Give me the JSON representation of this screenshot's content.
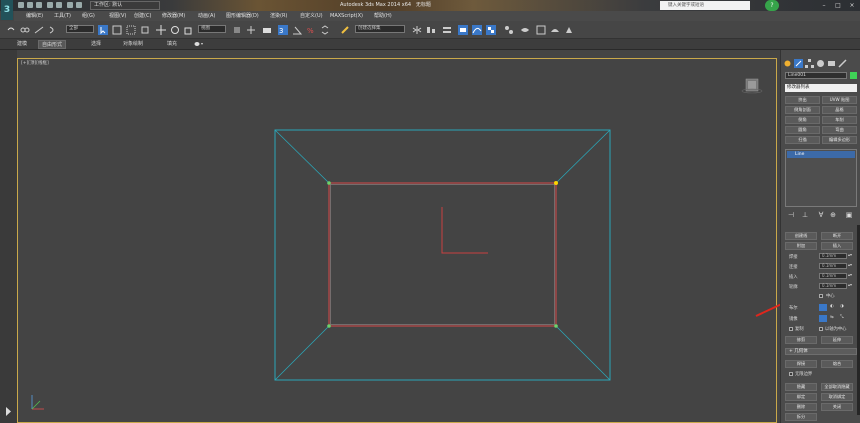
{
  "titlebar": {
    "workspace": "工作区: 默认",
    "window_title": "Autodesk 3ds Max  2014 x64",
    "file_name": "无标题",
    "search_placeholder": "键入关键字或短语",
    "help_symbol": "?"
  },
  "menu": {
    "items": [
      "编辑(E)",
      "工具(T)",
      "组(G)",
      "视图(V)",
      "创建(C)",
      "修改器(M)",
      "动画(A)",
      "图形编辑器(D)",
      "渲染(R)",
      "自定义(U)",
      "MAXScript(X)",
      "帮助(H)"
    ]
  },
  "toolbar": {
    "view_value": "全部",
    "ref_coord_value": "视图",
    "selection_set_value": "创建选择集"
  },
  "ribbon": {
    "tabs": [
      "建模",
      "自由形式",
      "选择",
      "对象绘制",
      "填充"
    ],
    "active_index": 1
  },
  "viewport": {
    "label": "[+][顶][线框]"
  },
  "command_panel": {
    "object_name": "Line001",
    "modifier_list": "修改器列表",
    "buttons": [
      "挤出",
      "UVW 贴图",
      "倒角剖面",
      "晶格",
      "倒角",
      "车削",
      "圆角",
      "弯曲",
      "扫描",
      "编辑多边形"
    ],
    "stack_item": "Line",
    "params": [
      {
        "label": "连接",
        "button": "附加"
      },
      {
        "label": "优化",
        "button": "插入"
      },
      {
        "label": "焊接",
        "value": "0.1mm"
      },
      {
        "label": "连接",
        "value": "0.1mm"
      },
      {
        "label": "插入",
        "value": "0.1mm"
      },
      {
        "label": "轮廓",
        "value": "0.1mm"
      }
    ],
    "center_label": "中心",
    "boolean_label": "布尔",
    "mirror_label": "镜像",
    "copy_label": "复制",
    "pivot_label": "以轴为中心",
    "trim_label": "修剪",
    "extend_label": "延伸",
    "infinite_label": "无限边界",
    "rollout_title": "+ 几何体",
    "bottom_buttons": [
      "隐藏",
      "全部取消隐藏",
      "绑定",
      "取消绑定",
      "删除",
      "关闭",
      "拆分"
    ]
  },
  "colors": {
    "viewport_bg": "#444444",
    "frame_outer": "#2aa6b8",
    "frame_inner": "#d64848",
    "vertex_green": "#6cd46c",
    "vertex_selected": "#ffd400",
    "annotation_arrow": "#e0261c"
  },
  "icons": {
    "app": "3ds-max-logo-icon",
    "help": "help-icon",
    "search": "search-icon"
  }
}
